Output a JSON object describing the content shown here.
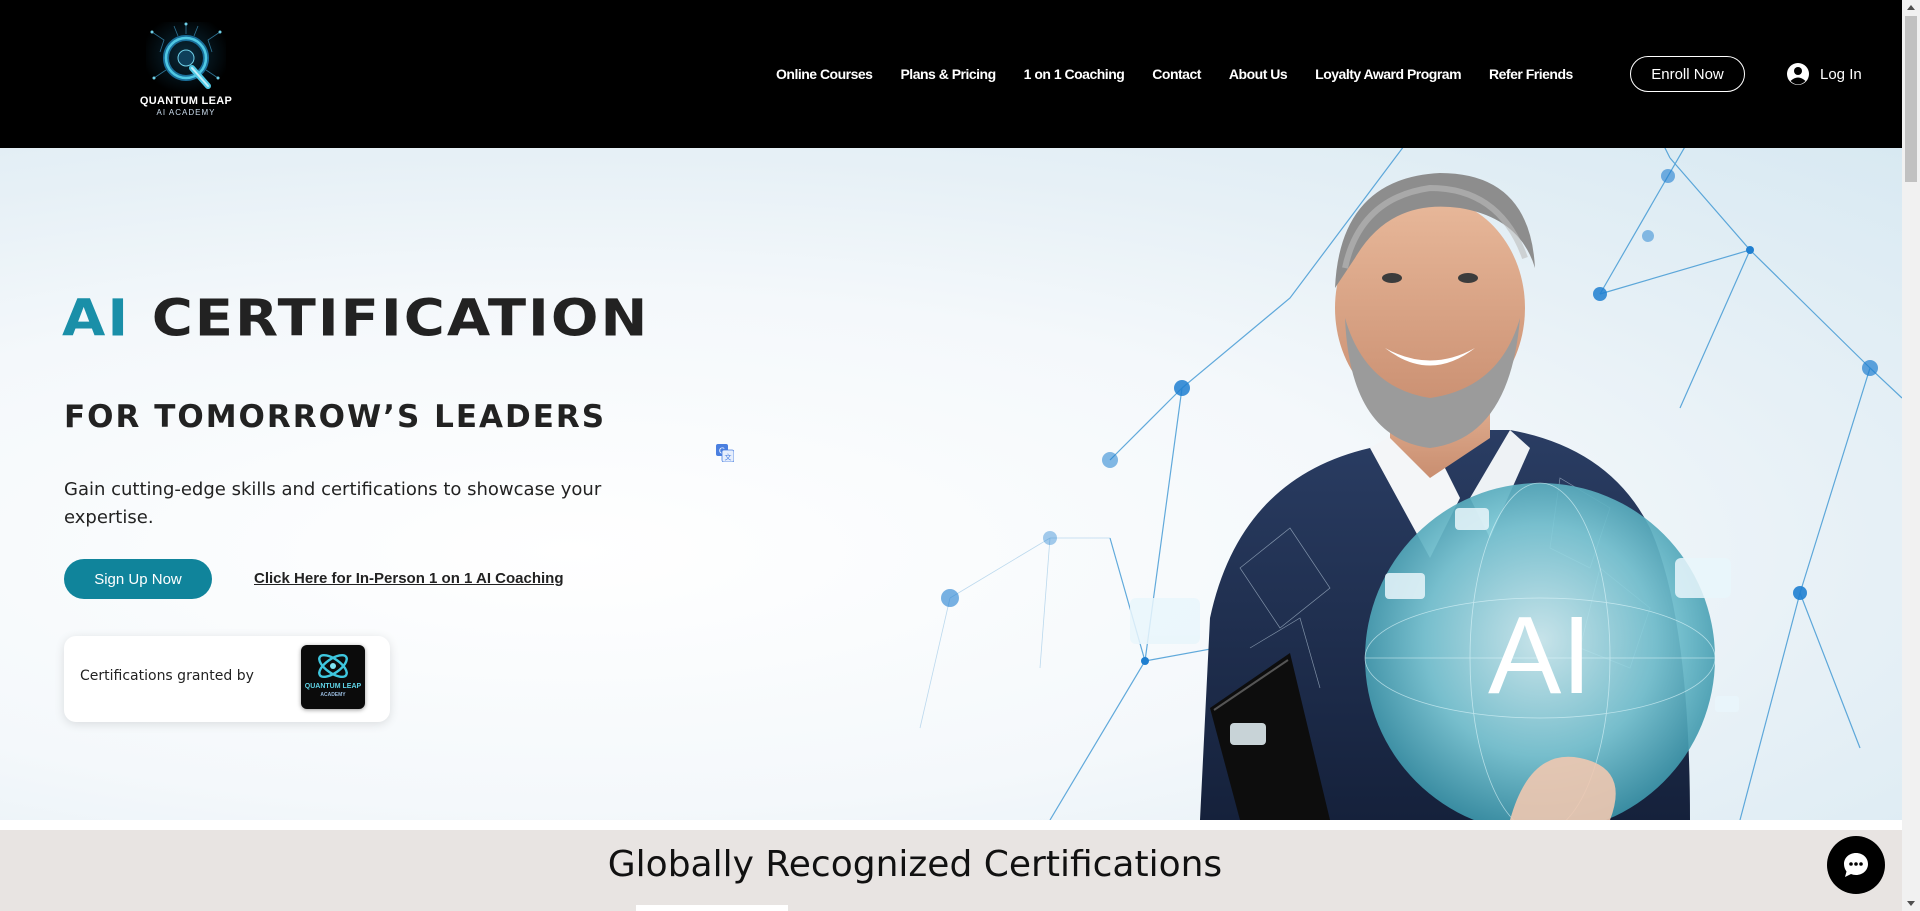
{
  "header": {
    "logo": {
      "brand": "QUANTUM LEAP",
      "subtitle": "AI ACADEMY"
    },
    "nav": [
      {
        "label": "Online Courses"
      },
      {
        "label": "Plans & Pricing"
      },
      {
        "label": "1 on 1 Coaching"
      },
      {
        "label": "Contact"
      },
      {
        "label": "About Us"
      },
      {
        "label": "Loyalty Award Program"
      },
      {
        "label": "Refer Friends"
      }
    ],
    "enroll_label": "Enroll Now",
    "login_label": "Log In"
  },
  "hero": {
    "title_accent": "AI",
    "title_rest": "CERTIFICATION",
    "subtitle": "FOR TOMORROW’S LEADERS",
    "description": "Gain cutting-edge skills and certifications to showcase your expertise.",
    "signup_label": "Sign Up Now",
    "coaching_link": "Click Here for In-Person 1 on 1 AI Coaching",
    "cert_card": {
      "label": "Certifications granted by",
      "badge_text": "QUANTUM LEAP",
      "badge_subtext": "ACADEMY"
    },
    "image_overlay_text": "AI"
  },
  "section": {
    "title": "Globally Recognized Certifications"
  },
  "colors": {
    "accent": "#1a8fa8",
    "button": "#10849b",
    "header_bg": "#000000",
    "section_bg": "#e8e4e2"
  },
  "icons": {
    "login": "user-circle-icon",
    "translate": "translate-icon",
    "chat": "chat-bubble-icon"
  }
}
